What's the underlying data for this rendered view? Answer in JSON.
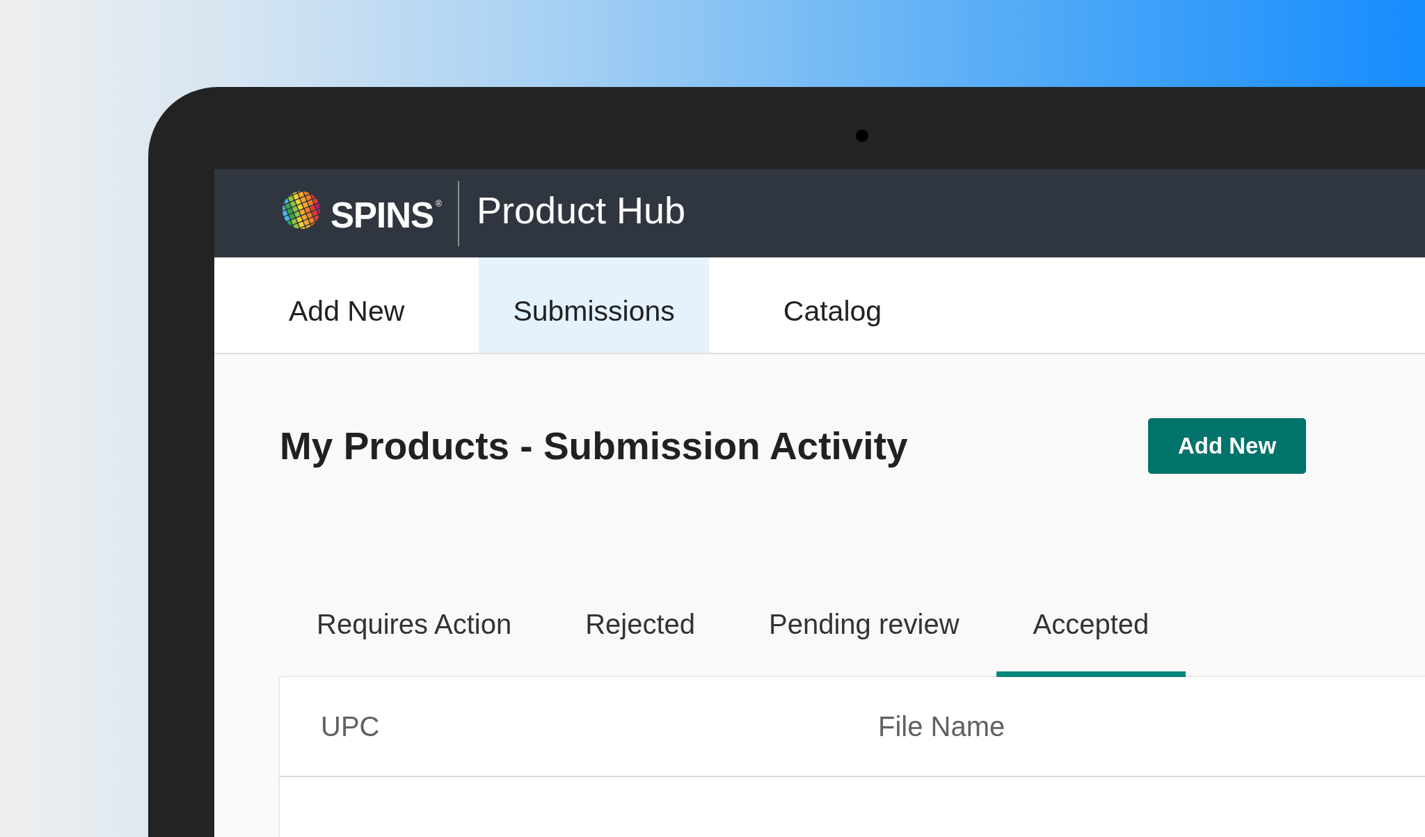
{
  "header": {
    "brand": "SPINS$^{®}$",
    "app_title": "Product Hub"
  },
  "nav_tabs": [
    {
      "label": "Add New",
      "selected": false
    },
    {
      "label": "Submissions",
      "selected": true
    },
    {
      "label": "Catalog",
      "selected": false
    }
  ],
  "page": {
    "title": "My Products - Submission Activity",
    "add_button": "Add New"
  },
  "status_tabs": [
    {
      "label": "Requires Action",
      "selected": false
    },
    {
      "label": "Rejected",
      "selected": false
    },
    {
      "label": "Pending review",
      "selected": false
    },
    {
      "label": "Accepted",
      "selected": true
    }
  ],
  "table": {
    "columns": [
      "UPC",
      "File Name"
    ]
  }
}
